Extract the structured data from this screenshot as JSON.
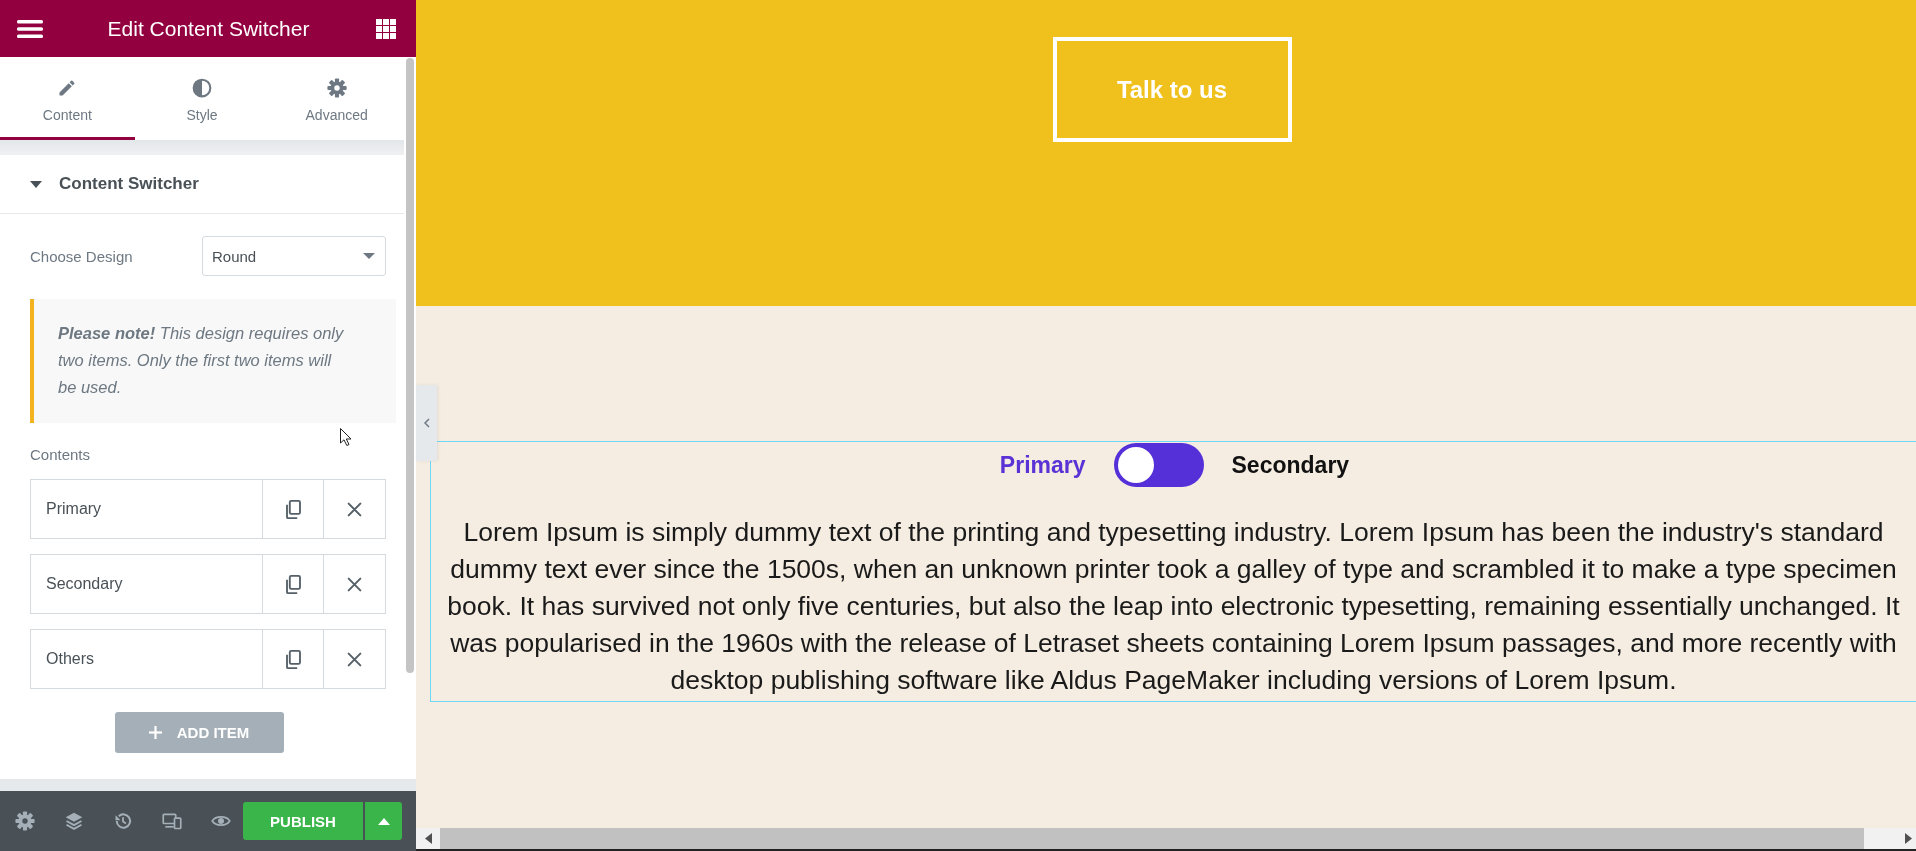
{
  "editor_panel": {
    "title": "Edit Content Switcher",
    "tabs": [
      {
        "label": "Content",
        "selected": true
      },
      {
        "label": "Style",
        "selected": false
      },
      {
        "label": "Advanced",
        "selected": false
      }
    ],
    "section": {
      "title": "Content Switcher",
      "expanded": true
    },
    "design_field": {
      "label": "Choose Design",
      "value": "Round"
    },
    "note": "**Please note!** This design requires only two items. Only the first two items will be used.",
    "contents": {
      "label": "Contents",
      "items": [
        {
          "title": "Primary"
        },
        {
          "title": "Secondary"
        },
        {
          "title": "Others"
        }
      ]
    },
    "add_button": "ADD ITEM",
    "publish_button": "PUBLISH"
  },
  "canvas": {
    "cta_button": "Talk to us",
    "switcher": {
      "options": [
        {
          "label": "Primary",
          "selected": true
        },
        {
          "label": "Secondary",
          "selected": false
        }
      ],
      "text": "Lorem Ipsum is simply dummy text of the printing and typesetting industry. Lorem Ipsum has been the industry's standard dummy text ever since the 1500s, when an unknown printer took a galley of type and scrambled it to make a type specimen book. It has survived not only five centuries, but also the leap into electronic typesetting, remaining essentially unchanged. It was popularised in the 1960s with the release of Letraset sheets containing Lorem Ipsum passages, and more recently with desktop publishing software like Aldus PageMaker including versions of Lorem Ipsum."
    }
  }
}
